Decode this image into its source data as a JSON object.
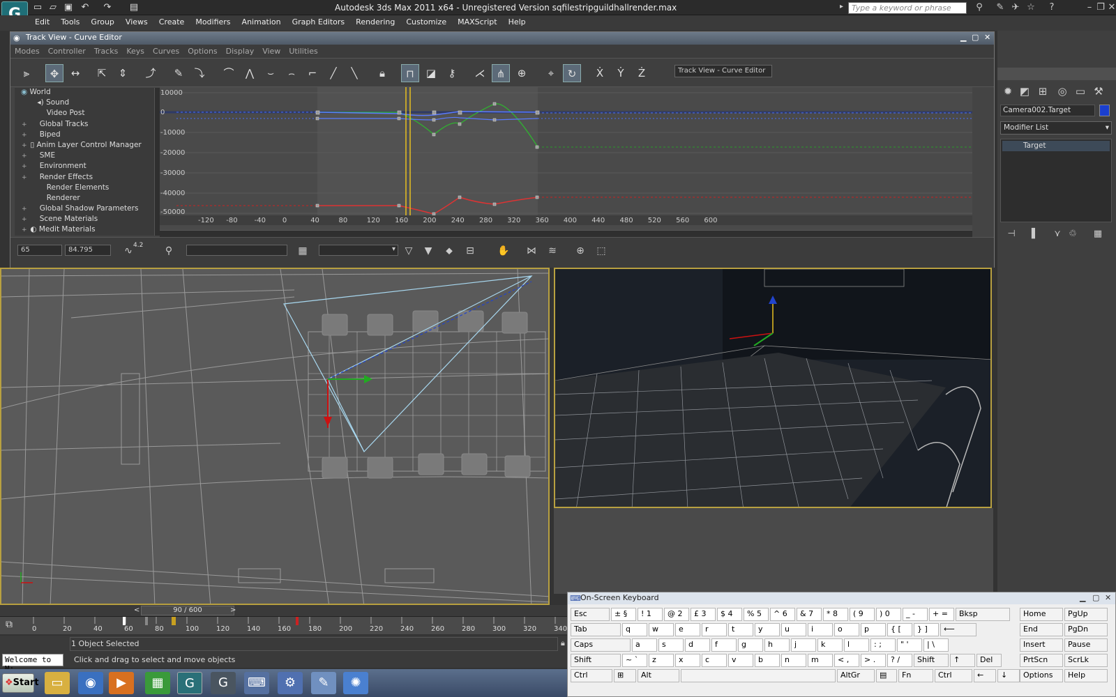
{
  "app": {
    "title": "Autodesk 3ds Max  2011 x64  -  Unregistered Version    sqfilestripguildhallrender.max",
    "search_placeholder": "Type a keyword or phrase",
    "menu": [
      "Edit",
      "Tools",
      "Group",
      "Views",
      "Create",
      "Modifiers",
      "Animation",
      "Graph Editors",
      "Rendering",
      "Customize",
      "MAXScript",
      "Help"
    ]
  },
  "track_view": {
    "title": "Track View - Curve Editor",
    "menu": [
      "Modes",
      "Controller",
      "Tracks",
      "Keys",
      "Curves",
      "Options",
      "Display",
      "View",
      "Utilities"
    ],
    "name_field": "Track View - Curve Editor",
    "tree": [
      {
        "label": "World",
        "expander": ""
      },
      {
        "label": "Sound",
        "expander": ""
      },
      {
        "label": "Video Post",
        "expander": ""
      },
      {
        "label": "Global Tracks",
        "expander": "+"
      },
      {
        "label": "Biped",
        "expander": "+"
      },
      {
        "label": "Anim Layer Control Manager",
        "expander": "+"
      },
      {
        "label": "SME",
        "expander": "+"
      },
      {
        "label": "Environment",
        "expander": "+"
      },
      {
        "label": "Render Effects",
        "expander": "+"
      },
      {
        "label": "Render Elements",
        "expander": ""
      },
      {
        "label": "Renderer",
        "expander": ""
      },
      {
        "label": "Global Shadow Parameters",
        "expander": "+"
      },
      {
        "label": "Scene Materials",
        "expander": "+"
      },
      {
        "label": "Medit Materials",
        "expander": "+"
      }
    ],
    "y_ticks": [
      "10000",
      "0",
      "-10000",
      "-20000",
      "-30000",
      "-40000",
      "-50000"
    ],
    "x_ticks": [
      "-120",
      "-80",
      "-40",
      "0",
      "40",
      "80",
      "120",
      "160",
      "200",
      "240",
      "280",
      "320",
      "360",
      "400",
      "440",
      "480",
      "520",
      "560",
      "600"
    ],
    "frame_field": "65",
    "value_field": "84.795",
    "scale_label": "4.2"
  },
  "command_panel": {
    "object_name": "Camera002.Target",
    "object_color": "#1a3fcf",
    "modifier_list": "Modifier List",
    "stack_item": "Target"
  },
  "timeline": {
    "slider": "90 / 600",
    "ticks": [
      "0",
      "20",
      "40",
      "60",
      "80",
      "100",
      "120",
      "140",
      "160",
      "180",
      "200",
      "220",
      "240",
      "260",
      "280",
      "300",
      "320",
      "340"
    ]
  },
  "status": {
    "selection": "1 Object Selected",
    "prompt": "Click and drag to select and move objects",
    "maxscript": "Welcome to M:"
  },
  "taskbar": {
    "start": "Start"
  },
  "osk": {
    "title": "On-Screen Keyboard",
    "row1": [
      "Esc",
      "± §",
      "! 1",
      "@ 2",
      "£ 3",
      "$ 4",
      "% 5",
      "^ 6",
      "& 7",
      "* 8",
      "( 9",
      ") 0",
      "_ -",
      "+ =",
      "Bksp"
    ],
    "row2": [
      "Tab",
      "q",
      "w",
      "e",
      "r",
      "t",
      "y",
      "u",
      "i",
      "o",
      "p",
      "{ [",
      "} ]"
    ],
    "row3": [
      "Caps",
      "a",
      "s",
      "d",
      "f",
      "g",
      "h",
      "j",
      "k",
      "l",
      ": ;",
      "\" '",
      "| \\"
    ],
    "row4": [
      "Shift",
      "~ `",
      "z",
      "x",
      "c",
      "v",
      "b",
      "n",
      "m",
      "< ,",
      "> .",
      "? /",
      "Shift",
      "↑",
      "Del"
    ],
    "row5": [
      "Ctrl",
      "⊞",
      "Alt",
      "",
      "AltGr",
      "▤",
      "Fn",
      "Ctrl",
      "←",
      "↓",
      "→"
    ],
    "nav": [
      "Home",
      "PgUp",
      "End",
      "PgDn",
      "Insert",
      "Pause",
      "PrtScn",
      "ScrLk",
      "Options",
      "Help"
    ]
  }
}
